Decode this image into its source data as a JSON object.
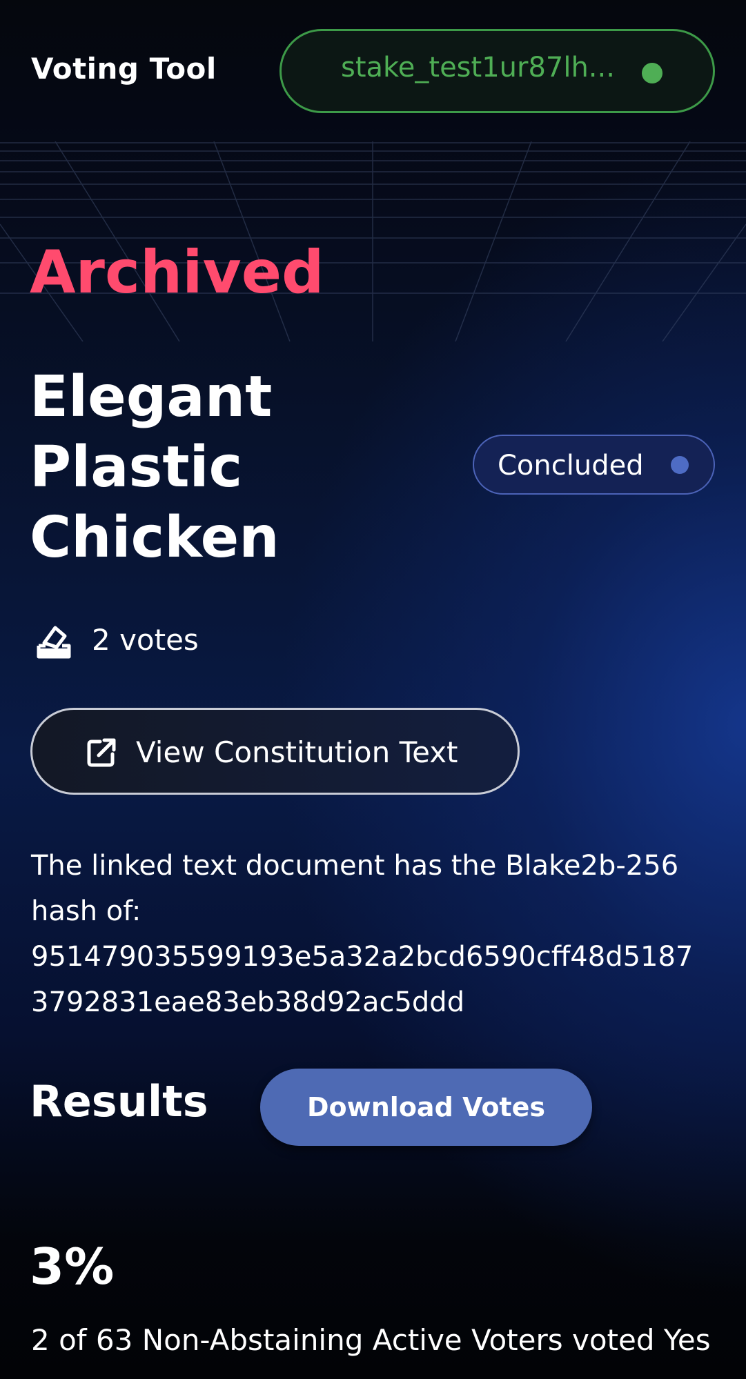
{
  "header": {
    "app_title": "Voting Tool",
    "wallet_address": "stake_test1ur87lh...",
    "wallet_status_color": "#4fae55"
  },
  "proposal": {
    "status_heading": "Archived",
    "title_lines": [
      "Elegant",
      "Plastic",
      "Chicken"
    ],
    "badge_label": "Concluded",
    "votes_label": "2 votes",
    "votes_icon": "ballot-box-icon",
    "constitution_button_label": "View Constitution Text",
    "constitution_button_icon": "external-link-icon",
    "hash_intro_lines": [
      "The linked text document has the Blake2b-256",
      "hash of:"
    ],
    "hash_lines": [
      "951479035599193e5a32a2bcd6590cff48d5187",
      "3792831eae83eb38d92ac5ddd"
    ]
  },
  "results": {
    "heading": "Results",
    "download_label": "Download Votes",
    "percent": "3%",
    "turnout_text": "2 of 63 Non-Abstaining Active Voters voted Yes"
  },
  "colors": {
    "archived": "#ff4b6e",
    "accent_blue": "#4e6ab4",
    "wallet_green": "#4fae55"
  }
}
